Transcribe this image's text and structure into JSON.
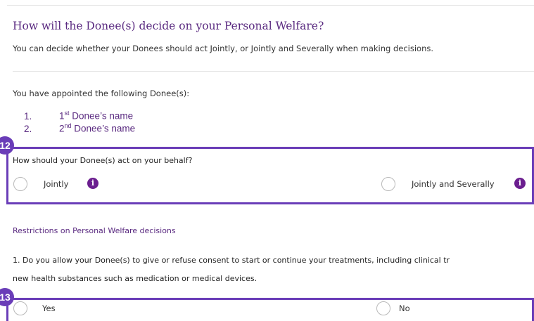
{
  "section": {
    "title": "How will the Donee(s) decide on your Personal Welfare?",
    "description": "You can decide whether your Donees should act Jointly, or Jointly and Severally when making decisions."
  },
  "appointed": {
    "intro": "You have appointed the following Donee(s):",
    "donees": [
      {
        "number": "1.",
        "ordinal": "1",
        "suffix": "st",
        "rest": " Donee’s name"
      },
      {
        "number": "2.",
        "ordinal": "2",
        "suffix": "nd",
        "rest": " Donee’s name"
      }
    ]
  },
  "step12": {
    "badge": "12",
    "question": "How should your Donee(s) act on your behalf?",
    "options": [
      {
        "label": "Jointly",
        "selected": false,
        "info_icon": "info-icon"
      },
      {
        "label": "Jointly and Severally",
        "selected": false,
        "info_icon": "info-icon"
      }
    ]
  },
  "restrictions": {
    "heading": "Restrictions on Personal Welfare decisions",
    "q1_line1": "1. Do you allow your Donee(s) to give or refuse consent to start or continue your treatments, including clinical tr",
    "q1_line2": "new health substances such as medication or medical devices."
  },
  "step13": {
    "badge": "13",
    "options": [
      {
        "label": "Yes",
        "selected": false
      },
      {
        "label": "No",
        "selected": false
      }
    ]
  },
  "colors": {
    "accent_purple": "#5a2a80",
    "highlight_box": "#6a3db8",
    "info_icon": "#6b1e8f"
  }
}
